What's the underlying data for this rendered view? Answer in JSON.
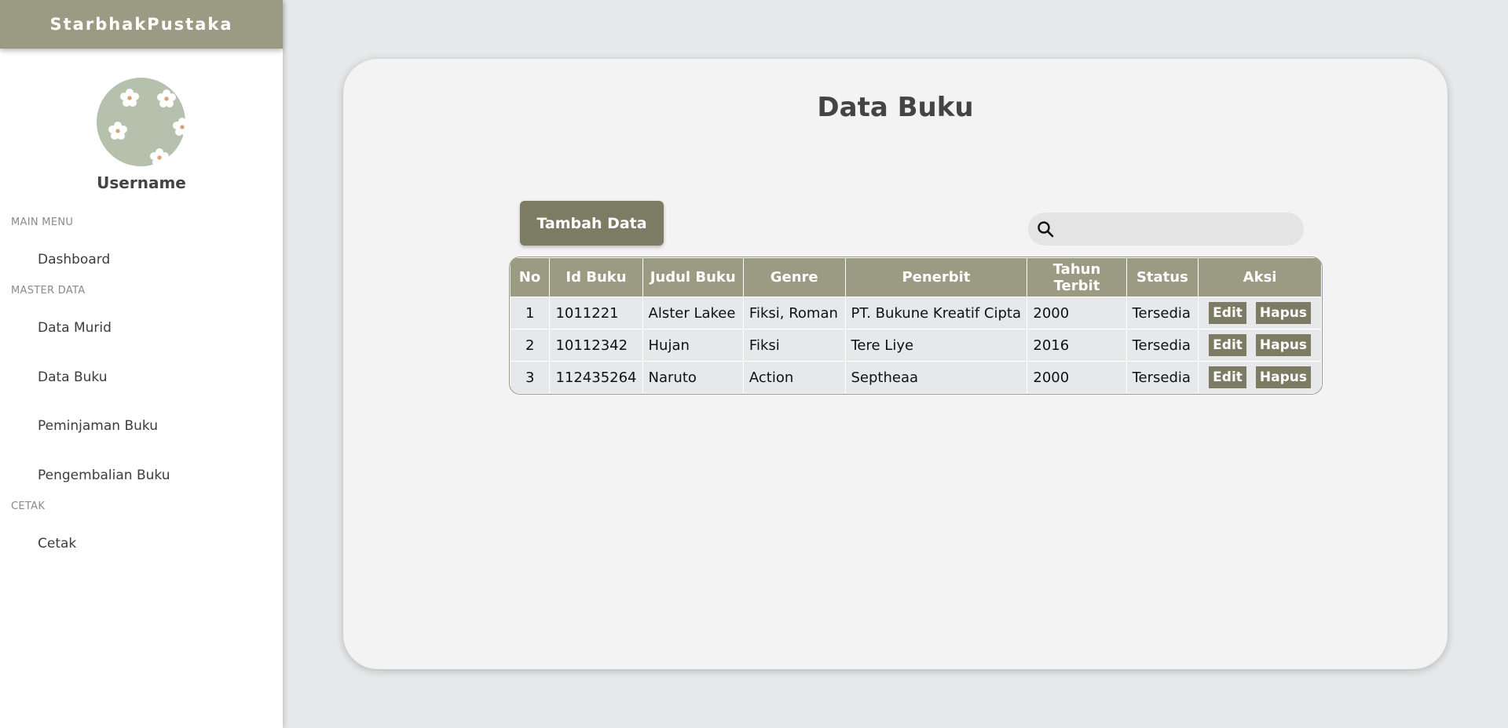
{
  "sidebar": {
    "brand": "StarbhakPustaka",
    "username": "Username",
    "sections": {
      "main_menu": "MAIN MENU",
      "master_data": "MASTER DATA",
      "cetak": "CETAK"
    },
    "items": {
      "dashboard": "Dashboard",
      "data_murid": "Data Murid",
      "data_buku": "Data Buku",
      "peminjaman_buku": "Peminjaman Buku",
      "pengembalian_buku": "Pengembalian Buku",
      "cetak": "Cetak"
    }
  },
  "main": {
    "title": "Data Buku",
    "add_button": "Tambah Data",
    "search": {
      "value": "",
      "placeholder": ""
    },
    "table": {
      "headers": [
        "No",
        "Id Buku",
        "Judul Buku",
        "Genre",
        "Penerbit",
        "Tahun Terbit",
        "Status",
        "Aksi"
      ],
      "rows": [
        [
          "1",
          "1011221",
          "Alster Lakee",
          "Fiksi, Roman",
          "PT. Bukune Kreatif Cipta",
          "2000",
          "Tersedia"
        ],
        [
          "2",
          "10112342",
          "Hujan",
          "Fiksi",
          "Tere Liye",
          "2016",
          "Tersedia"
        ],
        [
          "3",
          "112435264",
          "Naruto",
          "Action",
          "Septheaa",
          "2000",
          "Tersedia"
        ]
      ],
      "edit_label": "Edit",
      "delete_label": "Hapus"
    }
  },
  "colors": {
    "accent": "#9b9b83",
    "button": "#7c7b63",
    "background": "#e6e8e9",
    "card": "#f3f3f3",
    "avatar": "#b5c1ad"
  },
  "icons": {
    "search": "search-icon",
    "avatar": "flower-pattern-avatar"
  }
}
